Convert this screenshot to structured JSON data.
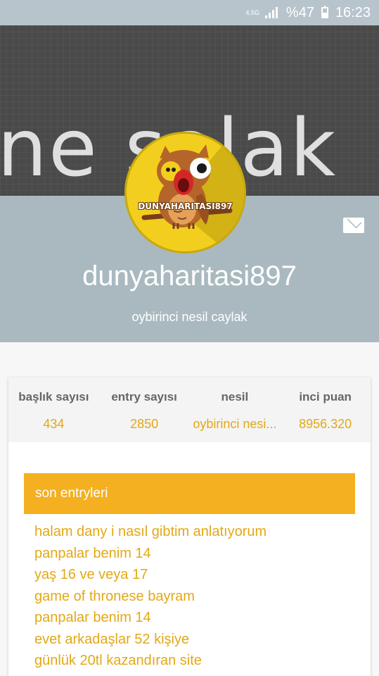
{
  "status_bar": {
    "network": "4.5G",
    "battery": "%47",
    "time": "16:23"
  },
  "profile": {
    "cover_text": "ne salak",
    "avatar_label": "DUNYAHARITASI897",
    "username": "dunyaharitasi897",
    "subtitle": "oybirinci nesil caylak"
  },
  "stats": [
    {
      "label": "başlık sayısı",
      "value": "434"
    },
    {
      "label": "entry sayısı",
      "value": "2850"
    },
    {
      "label": "nesil",
      "value": "oybirinci nesi..."
    },
    {
      "label": "inci puan",
      "value": "8956.320"
    }
  ],
  "recent": {
    "title": "son entryleri",
    "items": [
      "halam dany i nasıl gibtim anlatıyorum",
      "panpalar benim 14",
      "yaş 16 ve veya 17",
      "game of thronese bayram",
      "panpalar benim 14",
      "evet arkadaşlar 52 kişiye",
      "günlük 20tl kazandıran site"
    ]
  },
  "colors": {
    "accent": "#f4b020",
    "accent_text": "#e3a815",
    "header_bg": "#a9b9bf",
    "status_bar_bg": "#b8c4cb"
  },
  "icons": [
    "signal-icon",
    "battery-icon",
    "mail-icon",
    "owl-avatar-icon"
  ]
}
